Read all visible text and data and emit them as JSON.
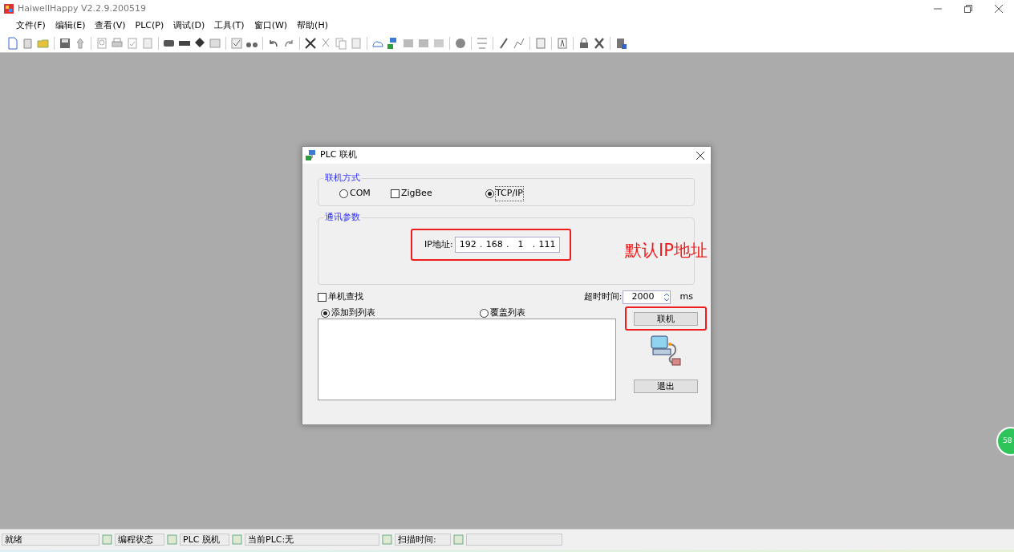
{
  "window": {
    "title": "HaiwellHappy V2.2.9.200519"
  },
  "menu": [
    "文件(F)",
    "编辑(E)",
    "查看(V)",
    "PLC(P)",
    "调试(D)",
    "工具(T)",
    "窗口(W)",
    "帮助(H)"
  ],
  "dialog": {
    "title": "PLC 联机",
    "connection_group": {
      "title": "联机方式",
      "options": [
        {
          "kind": "radio",
          "label": "COM",
          "selected": false
        },
        {
          "kind": "checkbox",
          "label": "ZigBee",
          "checked": false
        },
        {
          "kind": "radio",
          "label": "TCP/IP",
          "selected": true
        }
      ]
    },
    "comm_group": {
      "title": "通讯参数",
      "ip_label": "IP地址:",
      "ip_octets": [
        "192",
        "168",
        "1",
        "111"
      ],
      "ip_separator": "."
    },
    "annotation": "默认IP地址",
    "single_search": {
      "label": "单机查找",
      "checked": false
    },
    "timeout": {
      "label": "超时时间:",
      "value": "2000",
      "unit": "ms"
    },
    "list_modes": [
      {
        "label": "添加到列表",
        "selected": true
      },
      {
        "label": "覆盖列表",
        "selected": false
      }
    ],
    "connect_button": "联机",
    "exit_button": "退出"
  },
  "floating_badge": "58",
  "status_bar": [
    {
      "kind": "plain",
      "text": "就绪"
    },
    {
      "kind": "icon",
      "text": "编程状态"
    },
    {
      "kind": "icon",
      "text": "PLC 脱机"
    },
    {
      "kind": "icon",
      "text": "当前PLC:无"
    },
    {
      "kind": "icon",
      "text": "扫描时间:"
    },
    {
      "kind": "icon"
    }
  ]
}
